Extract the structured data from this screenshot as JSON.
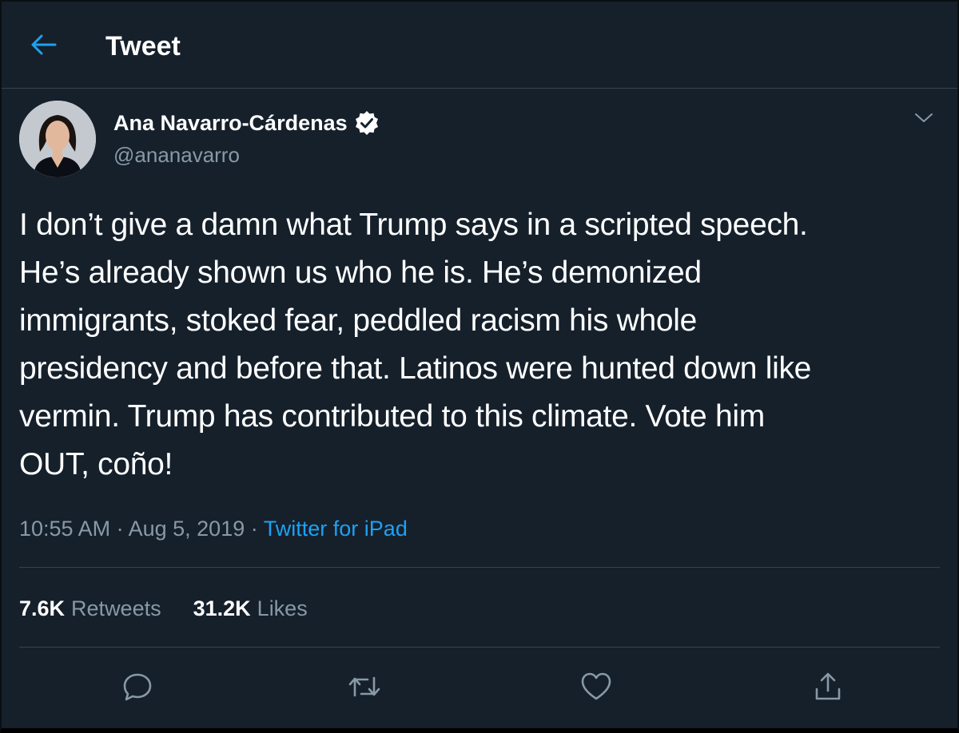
{
  "header": {
    "title": "Tweet",
    "back_icon": "arrow-left-icon"
  },
  "author": {
    "name": "Ana Navarro-Cárdenas",
    "handle": "@ananavarro",
    "verified": true,
    "avatar_icon": "profile-photo"
  },
  "tweet": {
    "text": "I don’t give a damn what Trump says in a scripted speech.\nHe’s already shown us who he is. He’s demonized\nimmigrants, stoked fear, peddled racism his whole\npresidency and before that. Latinos were hunted down like\nvermin. Trump has contributed to this climate. Vote him\nOUT, coño!",
    "time": "10:55 AM",
    "separator": "·",
    "date": "Aug 5, 2019",
    "source": "Twitter for iPad"
  },
  "stats": {
    "retweets_count": "7.6K",
    "retweets_label": "Retweets",
    "likes_count": "31.2K",
    "likes_label": "Likes"
  },
  "actions": [
    "reply-icon",
    "retweet-icon",
    "like-icon",
    "share-icon"
  ],
  "colors": {
    "background": "#15202b",
    "accent": "#1da1f2",
    "secondary_text": "#8899a6",
    "border": "#38444d"
  }
}
